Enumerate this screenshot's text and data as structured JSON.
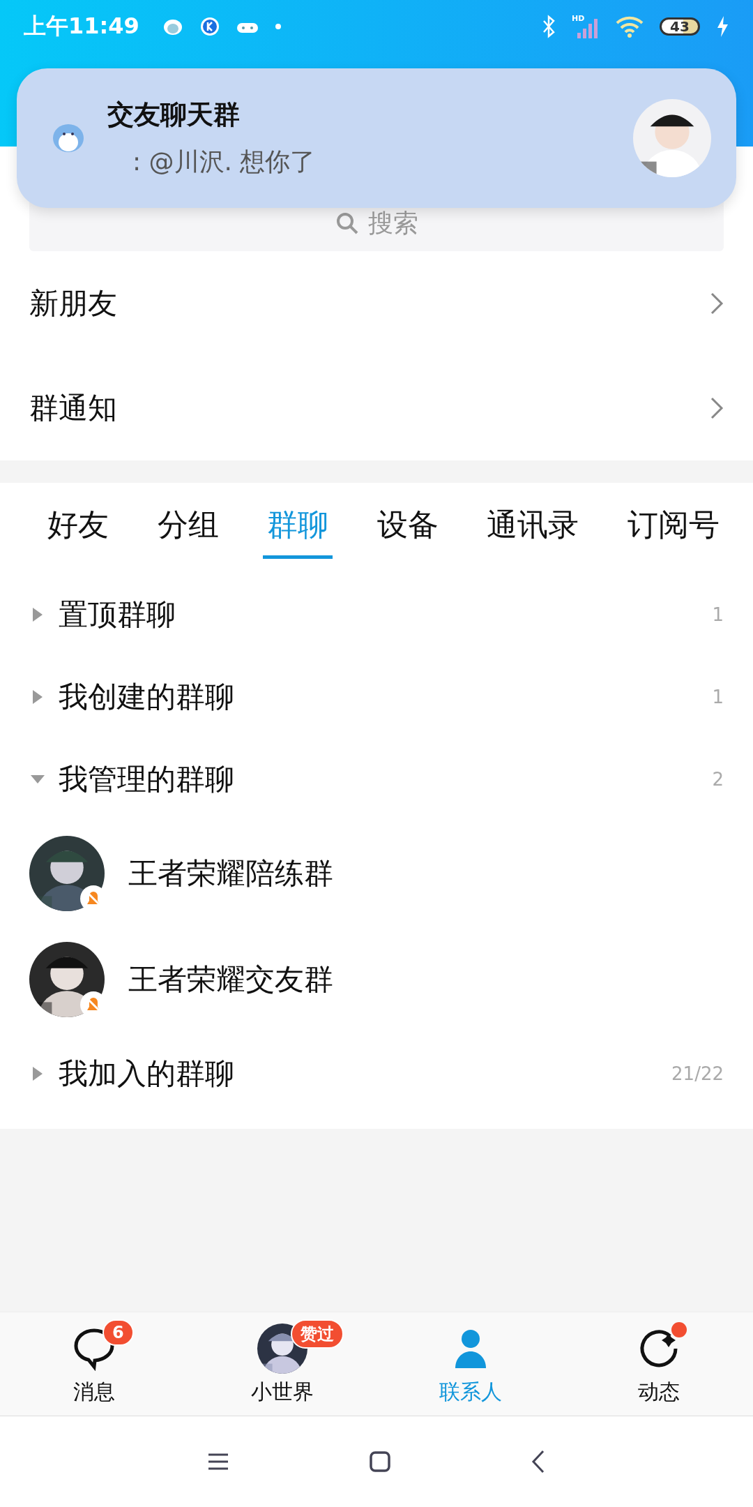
{
  "status_bar": {
    "time": "上午11:49",
    "battery": "43",
    "network": "HD"
  },
  "notification": {
    "title": "交友聊天群",
    "message": ": @川沢. 想你了"
  },
  "search": {
    "placeholder": "搜索"
  },
  "menu_rows": [
    {
      "label": "新朋友"
    },
    {
      "label": "群通知"
    }
  ],
  "tabs": [
    {
      "label": "好友",
      "selected": false
    },
    {
      "label": "分组",
      "selected": false
    },
    {
      "label": "群聊",
      "selected": true
    },
    {
      "label": "设备",
      "selected": false
    },
    {
      "label": "通讯录",
      "selected": false
    },
    {
      "label": "订阅号",
      "selected": false
    }
  ],
  "groups": [
    {
      "name": "置顶群聊",
      "count": "1",
      "expanded": false
    },
    {
      "name": "我创建的群聊",
      "count": "1",
      "expanded": false
    },
    {
      "name": "我管理的群聊",
      "count": "2",
      "expanded": true,
      "children": [
        {
          "name": "王者荣耀陪练群",
          "muted": true
        },
        {
          "name": "王者荣耀交友群",
          "muted": true
        }
      ]
    },
    {
      "name": "我加入的群聊",
      "count": "21/22",
      "expanded": false
    }
  ],
  "bottom_nav": [
    {
      "kind": "chat",
      "label": "消息",
      "badge": "6",
      "selected": false
    },
    {
      "kind": "avatar",
      "label": "小世界",
      "badge": "赞过",
      "selected": false
    },
    {
      "kind": "contacts",
      "label": "联系人",
      "selected": true
    },
    {
      "kind": "refresh",
      "label": "动态",
      "dot": true,
      "selected": false
    }
  ]
}
